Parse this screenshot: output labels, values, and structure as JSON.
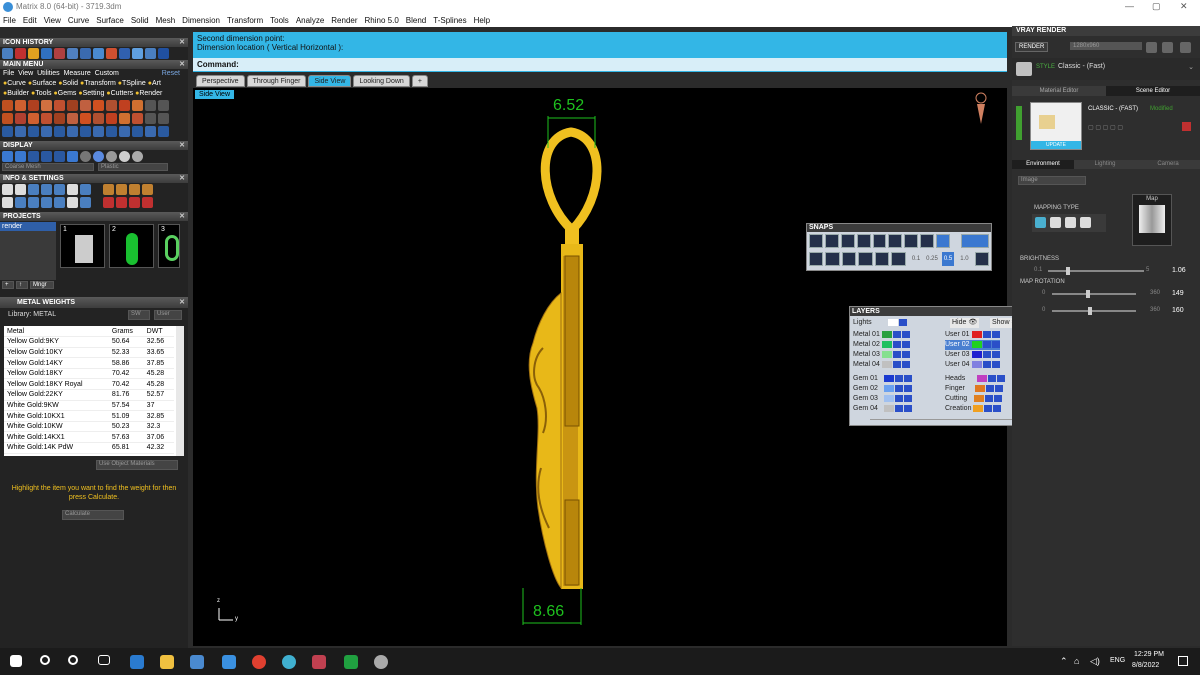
{
  "window": {
    "title": "Matrix 8.0 (64-bit) - 3719.3dm",
    "min": "—",
    "max": "▢",
    "close": "✕"
  },
  "menu": [
    "File",
    "Edit",
    "View",
    "Curve",
    "Surface",
    "Solid",
    "Mesh",
    "Dimension",
    "Transform",
    "Tools",
    "Analyze",
    "Render",
    "Rhino 5.0",
    "Blend",
    "T-Splines",
    "Help"
  ],
  "left": {
    "icon_history": "ICON HISTORY",
    "main_menu": "MAIN MENU",
    "mm_row1": [
      "File",
      "View",
      "Utilities",
      "Measure",
      "Custom"
    ],
    "mm_reset": "Reset",
    "mm_row2": [
      "Curve",
      "Surface",
      "Solid",
      "Transform",
      "TSpline",
      "Art"
    ],
    "mm_row3": [
      "Builder",
      "Tools",
      "Gems",
      "Setting",
      "Cutters",
      "Render"
    ],
    "display": "DISPLAY",
    "display_sel1": "Coarse Mesh",
    "display_sel2": "Plastic",
    "info": "INFO & SETTINGS",
    "projects": "PROJECTS",
    "project_name": "render",
    "thumbs": [
      "1",
      "2",
      "3"
    ],
    "mngr": "Mngr",
    "metal_weights": "METAL WEIGHTS",
    "library": "Library: METAL",
    "lib_btn1": "SW",
    "lib_btn2": "User",
    "mw_headers": [
      "Metal",
      "Grams",
      "DWT"
    ],
    "mw_rows": [
      [
        "Yellow Gold:9KY",
        "50.64",
        "32.56"
      ],
      [
        "Yellow Gold:10KY",
        "52.33",
        "33.65"
      ],
      [
        "Yellow Gold:14KY",
        "58.86",
        "37.85"
      ],
      [
        "Yellow Gold:18KY",
        "70.42",
        "45.28"
      ],
      [
        "Yellow Gold:18KY Royal",
        "70.42",
        "45.28"
      ],
      [
        "Yellow Gold:22KY",
        "81.76",
        "52.57"
      ],
      [
        "White Gold:9KW",
        "57.54",
        "37"
      ],
      [
        "White Gold:10KX1",
        "51.09",
        "32.85"
      ],
      [
        "White Gold:10KW",
        "50.23",
        "32.3"
      ],
      [
        "White Gold:14KX1",
        "57.63",
        "37.06"
      ],
      [
        "White Gold:14K PdW",
        "65.81",
        "42.32"
      ]
    ],
    "use_obj": "Use Object Materials",
    "hint": "Highlight the item you want to find the weight for then press Calculate.",
    "calc": "Calculate"
  },
  "command": {
    "line1": "Second dimension point:",
    "line2": "Dimension location ( Vertical  Horizontal ):",
    "label": "Command:"
  },
  "tabs": [
    "Perspective",
    "Through Finger",
    "Side View",
    "Looking Down",
    "+"
  ],
  "viewport": {
    "label": "Side View",
    "dim_top": "6.52",
    "dim_bottom": "8.66",
    "axis_z": "z",
    "axis_y": "y"
  },
  "snaps": {
    "title": "SNAPS",
    "vals": [
      "0.1",
      "0.25",
      "0.5",
      "1.0"
    ]
  },
  "layers": {
    "title": "LAYERS",
    "lights": "Lights",
    "hide": "Hide",
    "show": "Show",
    "left": [
      "Metal 01",
      "Metal 02",
      "Metal 03",
      "Metal 04",
      "Gem 01",
      "Gem 02",
      "Gem 03",
      "Gem 04"
    ],
    "right": [
      "User 01",
      "User 02",
      "User 03",
      "User 04",
      "Heads",
      "Finger",
      "Cutting",
      "Creation"
    ],
    "left_colors": [
      "#2aa040",
      "#1fc060",
      "#86e090",
      "#c0c0c0",
      "#1a3ad0",
      "#6aa0f0",
      "#a0c0f0",
      "#c0c0c0"
    ],
    "right_colors": [
      "#e02020",
      "#20d020",
      "#2020d0",
      "#8080e0",
      "#c040c0",
      "#e07820",
      "#e08020",
      "#f0a020"
    ]
  },
  "vray": {
    "title": "VRAY RENDER",
    "render": "RENDER",
    "res": "1280x960",
    "style_label": "STYLE",
    "style": "Classic - (Fast)",
    "tab1": "Material Editor",
    "tab2": "Scene Editor",
    "preset": "CLASSIC - (FAST)",
    "modified": "Modified",
    "update": "UPDATE",
    "envtabs": [
      "Environment",
      "Lighting",
      "Camera"
    ],
    "image_sel": "Image",
    "mapping": "MAPPING TYPE",
    "map": "Map",
    "brightness": "BRIGHTNESS",
    "b_min": "0.1",
    "b_max": "5",
    "b_val": "1.06",
    "maprot": "MAP ROTATION",
    "r_min": "0",
    "r_max": "360",
    "r_val1": "149",
    "r_val2": "160"
  },
  "taskbar": {
    "lang": "ENG",
    "time": "12:29 PM",
    "date": "8/8/2022"
  }
}
